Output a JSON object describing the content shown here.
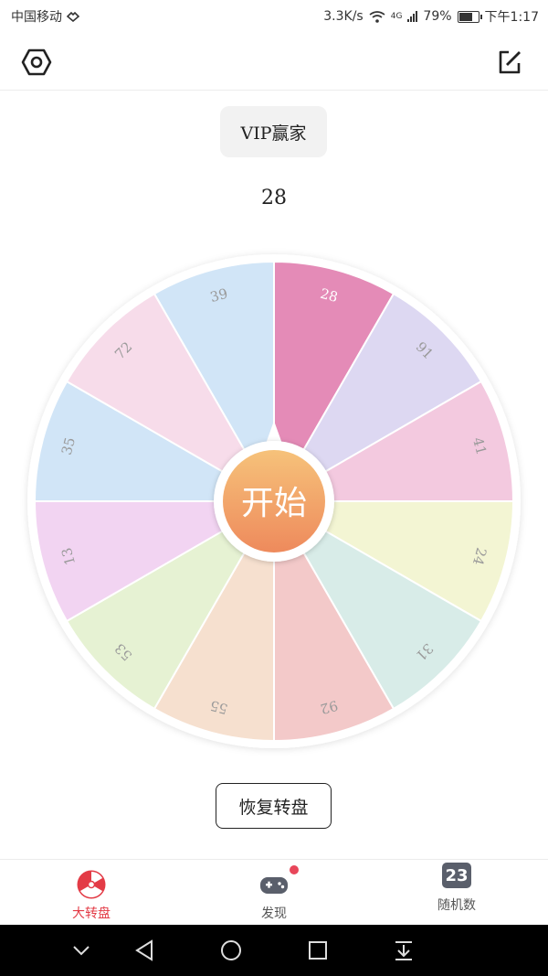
{
  "status_bar": {
    "carrier": "中国移动",
    "net_speed": "3.3K/s",
    "network_type": "4G",
    "battery_percent": "79%",
    "battery_level": 0.79,
    "time": "下午1:17"
  },
  "app_bar": {
    "settings_icon": "settings-hexagon-icon",
    "edit_icon": "edit-square-icon"
  },
  "vip_button": {
    "label": "VIP赢家"
  },
  "result": {
    "value": "28"
  },
  "wheel": {
    "center_label": "开始",
    "segments": [
      {
        "label": "28",
        "color": "#e48bb7",
        "text_color": "#ffffff"
      },
      {
        "label": "91",
        "color": "#ddd8f2",
        "text_color": "#9a9a9a"
      },
      {
        "label": "41",
        "color": "#f3c9df",
        "text_color": "#9a9a9a"
      },
      {
        "label": "24",
        "color": "#f3f5d3",
        "text_color": "#9a9a9a"
      },
      {
        "label": "31",
        "color": "#d8ece8",
        "text_color": "#9a9a9a"
      },
      {
        "label": "92",
        "color": "#f3c9c9",
        "text_color": "#9a9a9a"
      },
      {
        "label": "55",
        "color": "#f6e0cf",
        "text_color": "#9a9a9a"
      },
      {
        "label": "53",
        "color": "#e6f2d3",
        "text_color": "#9a9a9a"
      },
      {
        "label": "13",
        "color": "#f2d4f2",
        "text_color": "#9a9a9a"
      },
      {
        "label": "35",
        "color": "#d1e5f7",
        "text_color": "#9a9a9a"
      },
      {
        "label": "72",
        "color": "#f7dcea",
        "text_color": "#9a9a9a"
      },
      {
        "label": "39",
        "color": "#d1e5f7",
        "text_color": "#9a9a9a"
      }
    ]
  },
  "restore_button": {
    "label": "恢复转盘"
  },
  "bottom_nav": {
    "items": [
      {
        "label": "大转盘",
        "icon": "wheel-icon",
        "active": true
      },
      {
        "label": "发现",
        "icon": "gamepad-icon",
        "active": false,
        "badge": true
      },
      {
        "label": "随机数",
        "icon": "number-icon",
        "icon_text": "23",
        "active": false
      }
    ]
  },
  "colors": {
    "accent": "#e33b46",
    "start_gradient_top": "#f6c27a",
    "start_gradient_bottom": "#ee8a5c"
  }
}
